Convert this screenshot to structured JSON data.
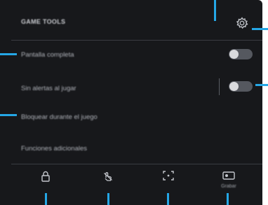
{
  "panel": {
    "title": "GAME TOOLS"
  },
  "settings": [
    {
      "label": "Pantalla completa",
      "toggle_on": false
    },
    {
      "label": "Sin alertas al jugar",
      "toggle_on": false
    },
    {
      "label": "Bloquear durante el juego"
    },
    {
      "label": "Funciones adicionales"
    }
  ],
  "tools": [
    {
      "icon": "lock-icon",
      "label": ""
    },
    {
      "icon": "touch-lock-icon",
      "label": ""
    },
    {
      "icon": "screenshot-icon",
      "label": ""
    },
    {
      "icon": "record-icon",
      "label": "Grabar"
    }
  ],
  "colors": {
    "panel_bg": "#17181b",
    "callout": "#25a7e6",
    "toggle_track": "#55585f",
    "toggle_knob": "#d9dadd"
  }
}
